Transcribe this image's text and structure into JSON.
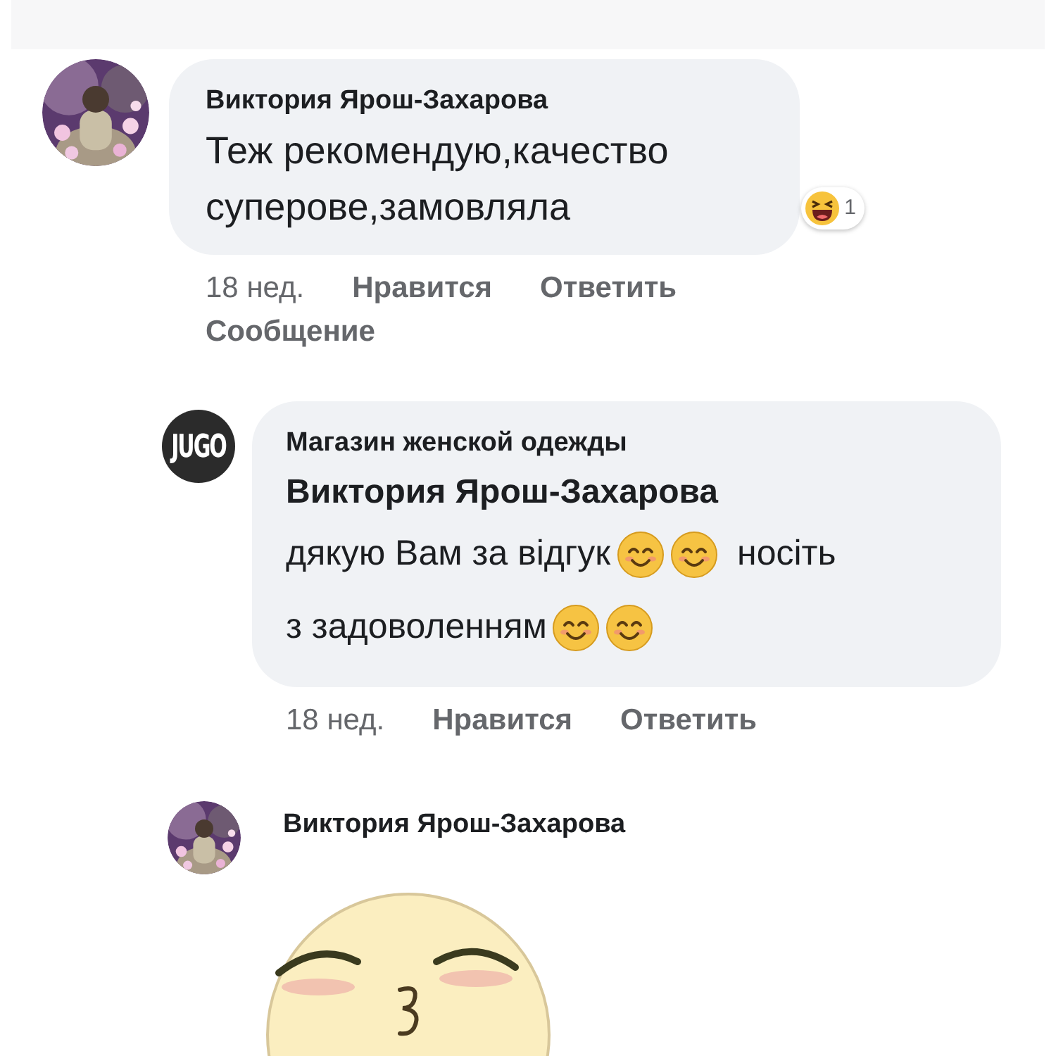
{
  "comments": [
    {
      "author": "Виктория Ярош-Захарова",
      "avatar": {
        "kind": "picture"
      },
      "body": "Теж рекомендую,качество суперове,замовляла",
      "reaction": {
        "kind": "laugh",
        "count": "1"
      },
      "actions": [
        "18 нед.",
        "Нравится",
        "Ответить",
        "Сообщение"
      ],
      "replies": [
        {
          "page_name": "Магазин женской одежды",
          "logo_text": "JUGO",
          "mention": "Виктория Ярош-Захарова",
          "lines": [
            [
              {
                "kind": "text",
                "text": "дякую Вам за відгук"
              },
              {
                "kind": "emoji"
              },
              {
                "kind": "emoji"
              },
              {
                "kind": "text",
                "text": "носіть"
              }
            ],
            [
              {
                "kind": "text",
                "text": "з задоволенням"
              },
              {
                "kind": "emoji"
              },
              {
                "kind": "emoji"
              }
            ]
          ],
          "actions": [
            "18 нед.",
            "Нравится",
            "Ответить"
          ]
        },
        {
          "author": "Виктория Ярош-Захарова",
          "avatar": {
            "kind": "picture"
          },
          "sticker": {
            "kind": "kiss-face"
          }
        }
      ]
    }
  ]
}
